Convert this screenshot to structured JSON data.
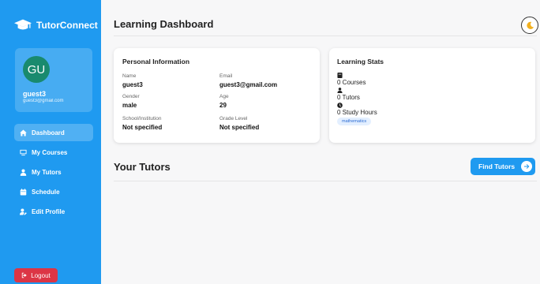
{
  "brand": {
    "name": "TutorConnect",
    "icon": "graduation-cap-icon"
  },
  "user": {
    "initials": "GU",
    "name": "guest3",
    "email": "guest3@gmail.com",
    "avatar_color": "#198a6e"
  },
  "nav": [
    {
      "label": "Dashboard",
      "icon": "home-icon",
      "active": true
    },
    {
      "label": "My Courses",
      "icon": "monitor-icon",
      "active": false
    },
    {
      "label": "My Tutors",
      "icon": "user-icon",
      "active": false
    },
    {
      "label": "Schedule",
      "icon": "calendar-icon",
      "active": false
    },
    {
      "label": "Edit Profile",
      "icon": "user-edit-icon",
      "active": false
    }
  ],
  "logout_label": "Logout",
  "page_title": "Learning Dashboard",
  "personal": {
    "title": "Personal Information",
    "name_label": "Name",
    "name": "guest3",
    "email_label": "Email",
    "email": "guest3@gmail.com",
    "gender_label": "Gender",
    "gender": "male",
    "age_label": "Age",
    "age": "29",
    "school_label": "School/Institution",
    "school": "Not specified",
    "grade_label": "Grade Level",
    "grade": "Not specified"
  },
  "stats": {
    "title": "Learning Stats",
    "courses": "0 Courses",
    "tutors": "0 Tutors",
    "hours": "0 Study Hours",
    "tag": "mathematics"
  },
  "tutors_section": {
    "title": "Your Tutors",
    "button": "Find Tutors"
  },
  "colors": {
    "primary": "#1f9af0",
    "logout": "#dc3545",
    "tag_bg": "#e3efff",
    "tag_text": "#2b6bd3"
  }
}
